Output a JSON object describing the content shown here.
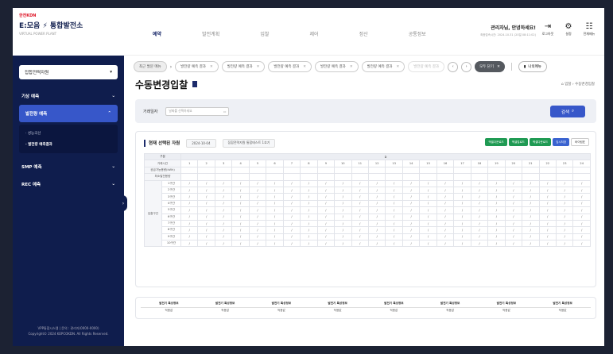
{
  "brand": {
    "corp": "한전KDN",
    "name": "E:모음 ⚡ 통합발전소",
    "sub": "VIRTUAL POWER PLANT"
  },
  "sidebar": {
    "select": "집합전력자원",
    "menus": [
      {
        "label": "기상 예측"
      },
      {
        "label": "발전량 예측"
      },
      {
        "label": "SMP 예측"
      },
      {
        "label": "REC 예측"
      }
    ],
    "sub_items": [
      "· 성능곡선",
      "· 발전량 예측결과"
    ],
    "footer1": "VPP통합시스템 | 문의 : 관리자(0000-0000)",
    "footer2": "Copyright© 2024 KEPCOKDN. All Rights Reserved."
  },
  "gnb": [
    "예약",
    "발전계획",
    "입찰",
    "제어",
    "정산",
    "공통정보"
  ],
  "user": {
    "greeting": "관리자님, 안녕하세요!",
    "login_info": "최종접속시간: 2024.10.31 (20일 08:11:02)"
  },
  "top_icons": [
    {
      "glyph": "⇥",
      "label": "로그아웃"
    },
    {
      "glyph": "⚙",
      "label": "설정"
    },
    {
      "glyph": "☷",
      "label": "전체메뉴"
    }
  ],
  "tabs": {
    "first": "최근 발문 메뉴",
    "items": [
      "발전량 예측 결과",
      "발전량 예측 결과",
      "발전량 예측 결과",
      "발전량 예측 결과",
      "발전량 예측 결과",
      "발전량 예측 결과"
    ],
    "close_all": "모두 닫기",
    "my_menu": "나의메뉴"
  },
  "page": {
    "title": "수동변경입찰",
    "crumb": "⌂ 입찰 › 수동변경입찰"
  },
  "search": {
    "label": "거래일자",
    "placeholder": "날짜를 선택하세요",
    "button": "검색"
  },
  "panel": {
    "title": "현재 선택된 자원",
    "date": "2024-10-04",
    "resource": "집합전력자원 통합테스트 1호기",
    "buttons": [
      "엑셀다운로드",
      "엑셀업로드",
      "엑셀다운로드",
      "임시저장",
      "바이림표"
    ]
  },
  "grid": {
    "h1": "구분",
    "h2": "D",
    "hours": [
      "1",
      "2",
      "3",
      "4",
      "5",
      "6",
      "7",
      "8",
      "9",
      "10",
      "11",
      "12",
      "13",
      "14",
      "15",
      "16",
      "17",
      "18",
      "19",
      "20",
      "21",
      "22",
      "23",
      "24"
    ],
    "rows_top": [
      "거래시간",
      "공급가능용량(kWh)",
      "최소발전용량"
    ],
    "group_label": "입찰구간",
    "segments": [
      "1구간",
      "2구간",
      "3구간",
      "4구간",
      "5구간",
      "6구간",
      "7구간",
      "8구간",
      "9구간",
      "10구간"
    ],
    "cell": "/"
  },
  "bottom": {
    "header": "발전기 특성정보",
    "value": "적용값",
    "count": 8
  }
}
